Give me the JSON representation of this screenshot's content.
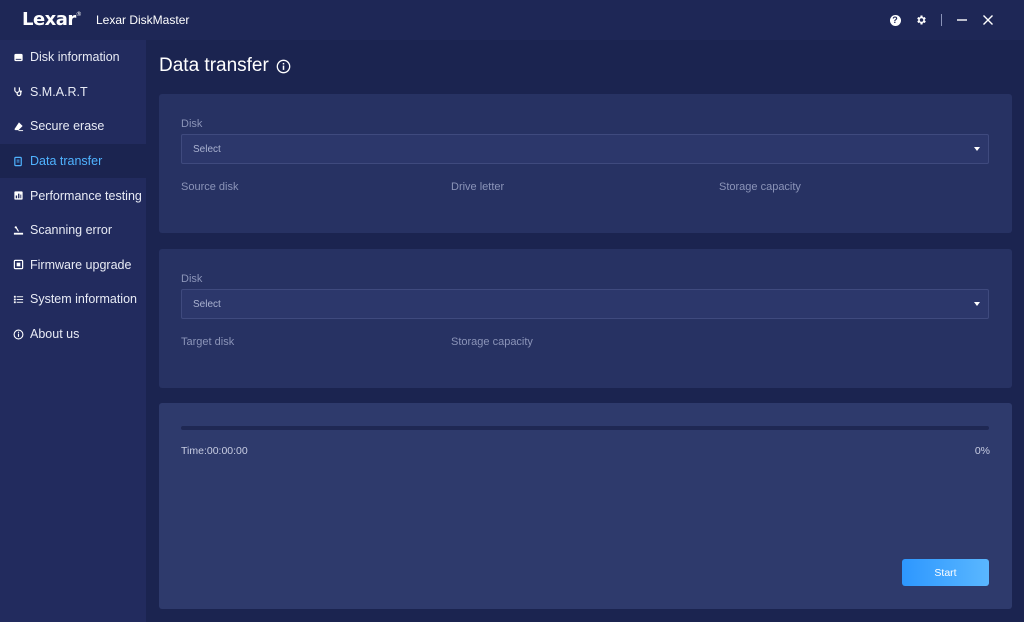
{
  "app": {
    "logo": "Lexar",
    "logo_mark": "®",
    "title": "Lexar DiskMaster"
  },
  "window_controls": [
    "help-icon",
    "gear-icon",
    "minimize-icon",
    "close-icon"
  ],
  "sidebar": {
    "items": [
      {
        "label": "Disk information",
        "icon": "disk-icon",
        "active": false
      },
      {
        "label": "S.M.A.R.T",
        "icon": "stethoscope-icon",
        "active": false
      },
      {
        "label": "Secure erase",
        "icon": "eraser-icon",
        "active": false
      },
      {
        "label": "Data transfer",
        "icon": "document-transfer-icon",
        "active": true
      },
      {
        "label": "Performance testing",
        "icon": "chart-icon",
        "active": false
      },
      {
        "label": "Scanning error",
        "icon": "scan-icon",
        "active": false
      },
      {
        "label": "Firmware upgrade",
        "icon": "chip-icon",
        "active": false
      },
      {
        "label": "System information",
        "icon": "list-icon",
        "active": false
      },
      {
        "label": "About us",
        "icon": "info-icon",
        "active": false
      }
    ]
  },
  "main": {
    "title": "Data transfer",
    "source": {
      "disk_label": "Disk",
      "select_value": "Select",
      "fields": [
        "Source disk",
        "Drive letter",
        "Storage capacity"
      ]
    },
    "target": {
      "disk_label": "Disk",
      "select_value": "Select",
      "fields": [
        "Target disk",
        "Storage capacity"
      ]
    },
    "progress": {
      "time": "Time:00:00:00",
      "percent_text": "0%",
      "value": 0,
      "start_label": "Start"
    }
  },
  "colors": {
    "accent": "#4fb3ff",
    "button": "#3aa0ff",
    "background": "#1b2450",
    "panel": "#273263"
  }
}
